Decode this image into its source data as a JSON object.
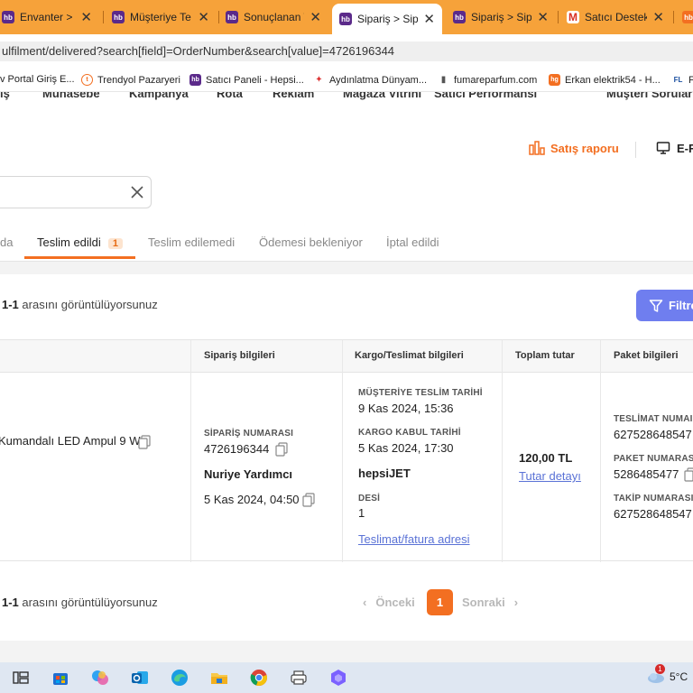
{
  "browser": {
    "tabs": [
      {
        "icon": "hb",
        "label": "Envanter > E"
      },
      {
        "icon": "hb",
        "label": "Müşteriye Te"
      },
      {
        "icon": "hb",
        "label": "Sonuçlanan T"
      },
      {
        "icon": "hb",
        "label": "Sipariş > Sip"
      },
      {
        "icon": "hb",
        "label": "Sipariş > Sip"
      },
      {
        "icon": "M",
        "label": "Satıcı Destek"
      },
      {
        "icon": "hb",
        "label": ""
      }
    ],
    "url": "ulfilment/delivered?search[field]=OrderNumber&search[value]=4726196344",
    "bookmarks": [
      {
        "label": "v Portal Giriş E..."
      },
      {
        "label": "Trendyol Pazaryeri"
      },
      {
        "label": "Satıcı Paneli - Hepsi..."
      },
      {
        "label": "Aydınlatma Dünyam..."
      },
      {
        "label": "fumareparfum.com"
      },
      {
        "label": "Erkan elektrik54 - H..."
      },
      {
        "label": "F"
      }
    ]
  },
  "seller_nav": {
    "items": [
      "ış",
      "Muhasebe",
      "Kampanya",
      "Rota",
      "Reklam",
      "Mağaza Vitrini",
      "Satıcı Performansı",
      "Müşteri Soruları"
    ]
  },
  "header": {
    "sales_report": "Satış raporu",
    "einvoice": "E-F"
  },
  "status_tabs": {
    "items": [
      {
        "label": "da"
      },
      {
        "label": "Teslim edildi",
        "count": "1"
      },
      {
        "label": "Teslim edilemedi"
      },
      {
        "label": "Ödemesi bekleniyor"
      },
      {
        "label": "İptal edildi"
      }
    ]
  },
  "results": {
    "range_bold": "1-1",
    "range_text": "arasını görüntülüyorsunuz",
    "filter_label": "Filtre"
  },
  "table": {
    "headers": [
      "Sipariş bilgileri",
      "Kargo/Teslimat bilgileri",
      "Toplam tutar",
      "Paket bilgileri"
    ],
    "row": {
      "product_name": "Kumandalı LED Ampul 9 W",
      "order_number_label": "SİPARİŞ NUMARASI",
      "order_number": "4726196344",
      "customer_name": "Nuriye Yardımcı",
      "order_date": "5 Kas 2024, 04:50",
      "delivery_date_label": "MÜŞTERİYE TESLİM TARİHİ",
      "delivery_date": "9 Kas 2024, 15:36",
      "cargo_accept_label": "KARGO KABUL TARİHİ",
      "cargo_accept_date": "5 Kas 2024, 17:30",
      "carrier": "hepsiJET",
      "desi_label": "DESİ",
      "desi": "1",
      "address_link": "Teslimat/fatura adresi",
      "total": "120,00 TL",
      "total_detail_link": "Tutar detayı",
      "delivery_number_label": "TESLİMAT NUMAI",
      "delivery_number": "627528648547",
      "package_number_label": "PAKET NUMARAS",
      "package_number": "5286485477",
      "tracking_number_label": "TAKİP NUMARASI",
      "tracking_number": "627528648547"
    }
  },
  "pagination": {
    "prev": "Önceki",
    "current": "1",
    "next": "Sonraki"
  },
  "taskbar": {
    "temperature": "5°C",
    "notification_count": "1"
  },
  "colors": {
    "accent": "#f36f21",
    "filter_button": "#6f7eef",
    "link": "#5a72d6",
    "tabstrip": "#f6a23a"
  }
}
